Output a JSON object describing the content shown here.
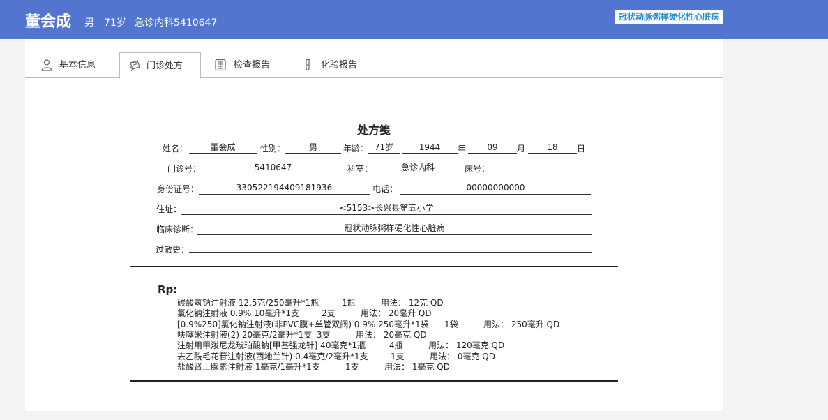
{
  "header": {
    "patient_name": "董会成",
    "sex": "男",
    "age": "71岁",
    "department_id": "急诊内科5410647",
    "diagnosis_badge": "冠状动脉粥样硬化性心脏病",
    "accent_color": "#5276cf"
  },
  "tabs": [
    {
      "label": "基本信息",
      "icon": "person-icon"
    },
    {
      "label": "门诊处方",
      "icon": "prescription-icon"
    },
    {
      "label": "检查报告",
      "icon": "report-icon"
    },
    {
      "label": "化验报告",
      "icon": "test-tube-icon"
    }
  ],
  "prescription": {
    "title": "处方笺",
    "labels": {
      "name": "姓名：",
      "sex": "性别：",
      "age": "年龄：",
      "year": "年",
      "month": "月",
      "day": "日",
      "clinic_no": "门诊号：",
      "dept": "科室：",
      "bed": "床号：",
      "id_no": "身份证号：",
      "phone": "电话：",
      "address": "住址：",
      "diagnosis": "临床诊断：",
      "allergy": "过敏史："
    },
    "values": {
      "name": "董会成",
      "sex": "男",
      "age": "71岁",
      "birth_year": "1944",
      "birth_month": "09",
      "birth_day": "18",
      "clinic_no": "5410647",
      "dept": "急诊内科",
      "bed": "",
      "id_no": "330522194409181936",
      "phone": "00000000000",
      "address": "<5153>长兴县第五小学",
      "diagnosis": "冠状动脉粥样硬化性心脏病",
      "allergy": ""
    },
    "rp_label": "Rp:",
    "meds": [
      {
        "name": "碳酸氢钠注射液 12.5克/250毫升*1瓶",
        "qty": "1瓶",
        "usage": "用法： 12克 QD"
      },
      {
        "name": "氯化钠注射液 0.9% 10毫升*1支",
        "qty": "2支",
        "usage": "用法： 20毫升 QD"
      },
      {
        "name": "[0.9%250]氯化钠注射液(非PVC膜+单管双阀) 0.9% 250毫升*1袋",
        "qty": "1袋",
        "usage": "用法： 250毫升 QD"
      },
      {
        "name": "呋噻米注射液(2) 20毫克/2毫升*1支",
        "qty": "3支",
        "usage": "用法： 20毫克 QD"
      },
      {
        "name": "注射用甲泼尼龙琥珀酸钠[甲基强龙针] 40毫克*1瓶",
        "qty": "4瓶",
        "usage": "用法： 120毫克 QD"
      },
      {
        "name": "去乙酰毛花苷注射液(西地兰针) 0.4毫克/2毫升*1支",
        "qty": "1支",
        "usage": "用法： 0毫克 QD"
      },
      {
        "name": "盐酸肾上腺素注射液 1毫克/1毫升*1支",
        "qty": "1支",
        "usage": "用法： 1毫克 QD"
      }
    ]
  }
}
